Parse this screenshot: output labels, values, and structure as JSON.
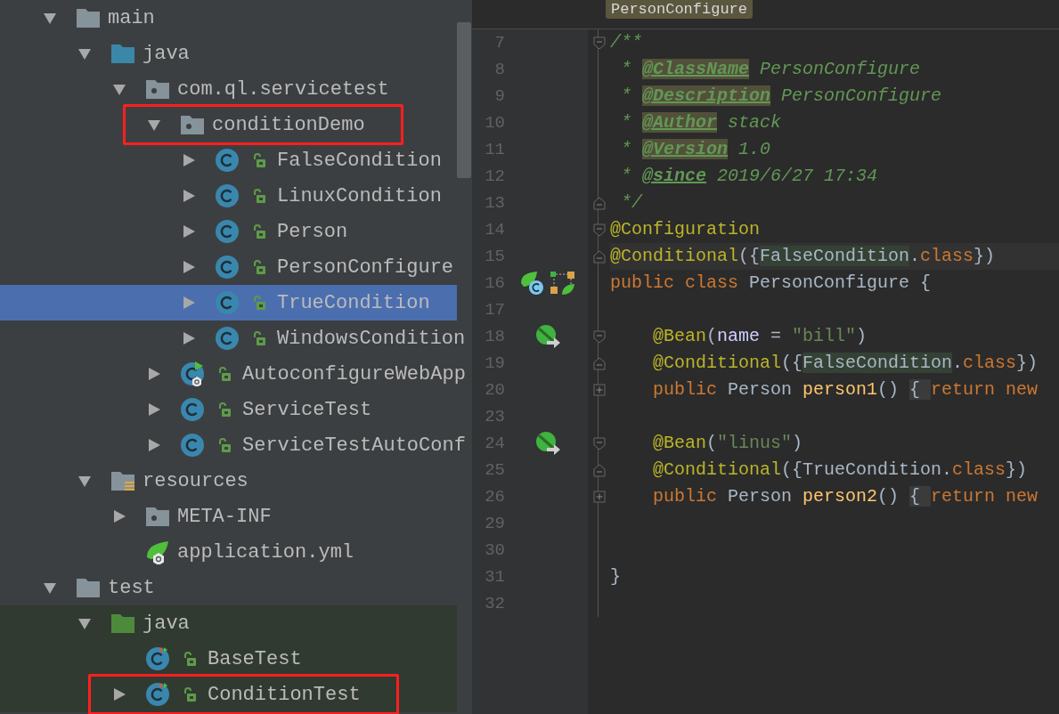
{
  "project_tree": {
    "items": [
      {
        "label": "main",
        "kind": "folder",
        "expanded": true,
        "selected": false,
        "children": [
          {
            "label": "java",
            "kind": "source-folder",
            "expanded": true,
            "selected": false,
            "children": [
              {
                "label": "com.ql.servicetest",
                "kind": "package",
                "expanded": true,
                "selected": false,
                "children": [
                  {
                    "label": "conditionDemo",
                    "kind": "package",
                    "expanded": true,
                    "selected": false,
                    "framed": true,
                    "children": [
                      {
                        "label": "FalseCondition",
                        "kind": "class",
                        "expanded": false,
                        "selected": false
                      },
                      {
                        "label": "LinuxCondition",
                        "kind": "class",
                        "expanded": false,
                        "selected": false
                      },
                      {
                        "label": "Person",
                        "kind": "class",
                        "expanded": false,
                        "selected": false
                      },
                      {
                        "label": "PersonConfigure",
                        "kind": "class",
                        "expanded": false,
                        "selected": false
                      },
                      {
                        "label": "TrueCondition",
                        "kind": "class",
                        "expanded": false,
                        "selected": true
                      },
                      {
                        "label": "WindowsCondition",
                        "kind": "class",
                        "expanded": false,
                        "selected": false
                      }
                    ]
                  },
                  {
                    "label": "AutoconfigureWebApp",
                    "kind": "spring-class",
                    "expanded": false,
                    "selected": false
                  },
                  {
                    "label": "ServiceTest",
                    "kind": "class",
                    "expanded": false,
                    "selected": false
                  },
                  {
                    "label": "ServiceTestAutoConf",
                    "kind": "class",
                    "expanded": false,
                    "selected": false
                  }
                ]
              }
            ]
          },
          {
            "label": "resources",
            "kind": "resources-folder",
            "expanded": true,
            "selected": false,
            "children": [
              {
                "label": "META-INF",
                "kind": "package",
                "expanded": false,
                "selected": false
              },
              {
                "label": "application.yml",
                "kind": "spring-yml",
                "selected": false
              }
            ]
          }
        ]
      },
      {
        "label": "test",
        "kind": "folder",
        "expanded": true,
        "selected": false,
        "children": [
          {
            "label": "java",
            "kind": "test-folder",
            "expanded": true,
            "selected": false,
            "test_scope": true,
            "children": [
              {
                "label": "BaseTest",
                "kind": "test-class",
                "selected": false,
                "test_scope": true
              },
              {
                "label": "ConditionTest",
                "kind": "test-class",
                "expanded": false,
                "selected": false,
                "test_scope": true,
                "framed": true
              }
            ]
          }
        ]
      }
    ]
  },
  "editor": {
    "breadcrumb": "PersonConfigure",
    "lines": [
      {
        "number": "7",
        "fold": {
          "kind": "start"
        },
        "tokens": [
          {
            "text": "/**",
            "kind": "comment"
          }
        ]
      },
      {
        "number": "8",
        "tokens": [
          {
            "text": " * ",
            "kind": "comment"
          },
          {
            "text": "@ClassName",
            "kind": "doc-tag-marked"
          },
          {
            "text": " PersonConfigure",
            "kind": "comment"
          }
        ]
      },
      {
        "number": "9",
        "tokens": [
          {
            "text": " * ",
            "kind": "comment"
          },
          {
            "text": "@Description",
            "kind": "doc-tag-marked"
          },
          {
            "text": " PersonConfigure",
            "kind": "comment"
          }
        ]
      },
      {
        "number": "10",
        "tokens": [
          {
            "text": " * ",
            "kind": "comment"
          },
          {
            "text": "@Author",
            "kind": "doc-tag-marked"
          },
          {
            "text": " stack",
            "kind": "comment"
          }
        ]
      },
      {
        "number": "11",
        "tokens": [
          {
            "text": " * ",
            "kind": "comment"
          },
          {
            "text": "@Version",
            "kind": "doc-tag-marked"
          },
          {
            "text": " 1.0",
            "kind": "comment"
          }
        ]
      },
      {
        "number": "12",
        "tokens": [
          {
            "text": " * ",
            "kind": "comment"
          },
          {
            "text": "@since",
            "kind": "doc-tag"
          },
          {
            "text": " 2019/6/27 17:34",
            "kind": "comment"
          }
        ]
      },
      {
        "number": "13",
        "fold": {
          "kind": "end"
        },
        "tokens": [
          {
            "text": " */",
            "kind": "comment"
          }
        ]
      },
      {
        "number": "14",
        "fold": {
          "kind": "start"
        },
        "tokens": [
          {
            "text": "@Configuration",
            "kind": "annotation"
          }
        ]
      },
      {
        "number": "15",
        "fold": {
          "kind": "end"
        },
        "current": true,
        "tokens": [
          {
            "text": "@Conditional",
            "kind": "annotation"
          },
          {
            "text": "({",
            "kind": "plain"
          },
          {
            "text": "FalseCondition",
            "kind": "usage"
          },
          {
            "text": ".",
            "kind": "plain"
          },
          {
            "text": "class",
            "kind": "keyword"
          },
          {
            "text": "})",
            "kind": "plain"
          }
        ]
      },
      {
        "number": "16",
        "gutter": [
          {
            "kind": "spring-class"
          },
          {
            "kind": "diagram"
          }
        ],
        "tokens": [
          {
            "text": "public class",
            "kind": "keyword"
          },
          {
            "text": " PersonConfigure {",
            "kind": "plain"
          }
        ]
      },
      {
        "number": "17"
      },
      {
        "number": "18",
        "fold": {
          "kind": "start"
        },
        "gutter": [
          {
            "kind": "bean"
          }
        ],
        "tokens": [
          {
            "text": "    @Bean",
            "kind": "annotation"
          },
          {
            "text": "(",
            "kind": "plain"
          },
          {
            "text": "name",
            "kind": "param"
          },
          {
            "text": " = ",
            "kind": "plain"
          },
          {
            "text": "\"bill\"",
            "kind": "string"
          },
          {
            "text": ")",
            "kind": "plain"
          }
        ]
      },
      {
        "number": "19",
        "fold": {
          "kind": "end"
        },
        "tokens": [
          {
            "text": "    @Conditional",
            "kind": "annotation"
          },
          {
            "text": "({",
            "kind": "plain"
          },
          {
            "text": "FalseCondition",
            "kind": "usage"
          },
          {
            "text": ".",
            "kind": "plain"
          },
          {
            "text": "class",
            "kind": "keyword"
          },
          {
            "text": "})",
            "kind": "plain"
          }
        ]
      },
      {
        "number": "20",
        "fold": {
          "kind": "collapsed"
        },
        "tokens": [
          {
            "text": "    public",
            "kind": "keyword"
          },
          {
            "text": " Person ",
            "kind": "plain"
          },
          {
            "text": "person1",
            "kind": "method"
          },
          {
            "text": "() ",
            "kind": "plain"
          },
          {
            "text": "{ ",
            "kind": "folded"
          },
          {
            "text": "return new",
            "kind": "keyword"
          }
        ]
      },
      {
        "number": "23"
      },
      {
        "number": "24",
        "fold": {
          "kind": "start"
        },
        "gutter": [
          {
            "kind": "bean"
          }
        ],
        "tokens": [
          {
            "text": "    @Bean",
            "kind": "annotation"
          },
          {
            "text": "(",
            "kind": "plain"
          },
          {
            "text": "\"linus\"",
            "kind": "string"
          },
          {
            "text": ")",
            "kind": "plain"
          }
        ]
      },
      {
        "number": "25",
        "fold": {
          "kind": "end"
        },
        "tokens": [
          {
            "text": "    @Conditional",
            "kind": "annotation"
          },
          {
            "text": "({TrueCondition.",
            "kind": "plain"
          },
          {
            "text": "class",
            "kind": "keyword"
          },
          {
            "text": "})",
            "kind": "plain"
          }
        ]
      },
      {
        "number": "26",
        "fold": {
          "kind": "collapsed"
        },
        "tokens": [
          {
            "text": "    public",
            "kind": "keyword"
          },
          {
            "text": " Person ",
            "kind": "plain"
          },
          {
            "text": "person2",
            "kind": "method"
          },
          {
            "text": "() ",
            "kind": "plain"
          },
          {
            "text": "{ ",
            "kind": "folded"
          },
          {
            "text": "return new",
            "kind": "keyword"
          }
        ]
      },
      {
        "number": "29"
      },
      {
        "number": "30"
      },
      {
        "number": "31",
        "tokens": [
          {
            "text": "}",
            "kind": "plain"
          }
        ]
      },
      {
        "number": "32"
      }
    ]
  }
}
